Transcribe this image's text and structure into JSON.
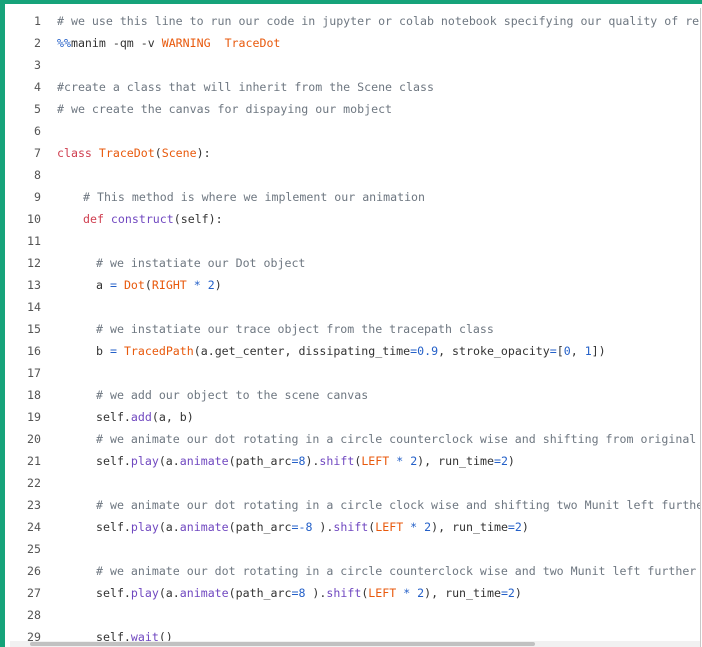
{
  "lines": [
    {
      "num": "1",
      "indent": 0,
      "tokens": [
        {
          "t": "# we use this line to run our code in jupyter or colab notebook specifying our quality of rendering",
          "c": "c"
        }
      ]
    },
    {
      "num": "2",
      "indent": 0,
      "tokens": [
        {
          "t": "%%",
          "c": "n"
        },
        {
          "t": "manim -qm -v ",
          "c": "p"
        },
        {
          "t": "WARNING",
          "c": "o"
        },
        {
          "t": "  ",
          "c": "p"
        },
        {
          "t": "TraceDot",
          "c": "o"
        }
      ]
    },
    {
      "num": "3",
      "indent": 0,
      "tokens": []
    },
    {
      "num": "4",
      "indent": 0,
      "tokens": [
        {
          "t": "#create a class that will inherit from the Scene class",
          "c": "c"
        }
      ]
    },
    {
      "num": "5",
      "indent": 0,
      "tokens": [
        {
          "t": "# we create the canvas for dispaying our mobject",
          "c": "c"
        }
      ]
    },
    {
      "num": "6",
      "indent": 0,
      "tokens": []
    },
    {
      "num": "7",
      "indent": 0,
      "tokens": [
        {
          "t": "class ",
          "c": "k"
        },
        {
          "t": "TraceDot",
          "c": "o"
        },
        {
          "t": "(",
          "c": "p"
        },
        {
          "t": "Scene",
          "c": "o"
        },
        {
          "t": "):",
          "c": "p"
        }
      ]
    },
    {
      "num": "8",
      "indent": 0,
      "tokens": []
    },
    {
      "num": "9",
      "indent": 1,
      "tokens": [
        {
          "t": "# This method is where we implement our animation",
          "c": "c"
        }
      ]
    },
    {
      "num": "10",
      "indent": 1,
      "tokens": [
        {
          "t": "def ",
          "c": "k"
        },
        {
          "t": "construct",
          "c": "f"
        },
        {
          "t": "(self):",
          "c": "p"
        }
      ]
    },
    {
      "num": "11",
      "indent": 0,
      "tokens": []
    },
    {
      "num": "12",
      "indent": 2,
      "tokens": [
        {
          "t": "# we instatiate our Dot object",
          "c": "c"
        }
      ]
    },
    {
      "num": "13",
      "indent": 2,
      "tokens": [
        {
          "t": "a ",
          "c": "p"
        },
        {
          "t": "=",
          "c": "n"
        },
        {
          "t": " ",
          "c": "p"
        },
        {
          "t": "Dot",
          "c": "o"
        },
        {
          "t": "(",
          "c": "p"
        },
        {
          "t": "RIGHT",
          "c": "o"
        },
        {
          "t": " * ",
          "c": "n"
        },
        {
          "t": "2",
          "c": "n"
        },
        {
          "t": ")",
          "c": "p"
        }
      ]
    },
    {
      "num": "14",
      "indent": 0,
      "tokens": []
    },
    {
      "num": "15",
      "indent": 2,
      "tokens": [
        {
          "t": "# we instatiate our trace object from the tracepath class",
          "c": "c"
        }
      ]
    },
    {
      "num": "16",
      "indent": 2,
      "tokens": [
        {
          "t": "b ",
          "c": "p"
        },
        {
          "t": "=",
          "c": "n"
        },
        {
          "t": " ",
          "c": "p"
        },
        {
          "t": "TracedPath",
          "c": "o"
        },
        {
          "t": "(a.get_center, dissipating_time",
          "c": "p"
        },
        {
          "t": "=",
          "c": "n"
        },
        {
          "t": "0.9",
          "c": "n"
        },
        {
          "t": ", stroke_opacity",
          "c": "p"
        },
        {
          "t": "=",
          "c": "n"
        },
        {
          "t": "[",
          "c": "p"
        },
        {
          "t": "0",
          "c": "n"
        },
        {
          "t": ", ",
          "c": "p"
        },
        {
          "t": "1",
          "c": "n"
        },
        {
          "t": "])",
          "c": "p"
        }
      ]
    },
    {
      "num": "17",
      "indent": 0,
      "tokens": []
    },
    {
      "num": "18",
      "indent": 2,
      "tokens": [
        {
          "t": "# we add our object to the scene canvas",
          "c": "c"
        }
      ]
    },
    {
      "num": "19",
      "indent": 2,
      "tokens": [
        {
          "t": "self.",
          "c": "p"
        },
        {
          "t": "add",
          "c": "f"
        },
        {
          "t": "(a, b)",
          "c": "p"
        }
      ]
    },
    {
      "num": "20",
      "indent": 2,
      "tokens": [
        {
          "t": "# we animate our dot rotating in a circle counterclock wise and shifting from original positi",
          "c": "c"
        }
      ]
    },
    {
      "num": "21",
      "indent": 2,
      "tokens": [
        {
          "t": "self.",
          "c": "p"
        },
        {
          "t": "play",
          "c": "f"
        },
        {
          "t": "(a.",
          "c": "p"
        },
        {
          "t": "animate",
          "c": "f"
        },
        {
          "t": "(path_arc",
          "c": "p"
        },
        {
          "t": "=",
          "c": "n"
        },
        {
          "t": "8",
          "c": "n"
        },
        {
          "t": ").",
          "c": "p"
        },
        {
          "t": "shift",
          "c": "f"
        },
        {
          "t": "(",
          "c": "p"
        },
        {
          "t": "LEFT",
          "c": "o"
        },
        {
          "t": " * ",
          "c": "n"
        },
        {
          "t": "2",
          "c": "n"
        },
        {
          "t": "), run_time",
          "c": "p"
        },
        {
          "t": "=",
          "c": "n"
        },
        {
          "t": "2",
          "c": "n"
        },
        {
          "t": ")",
          "c": "p"
        }
      ]
    },
    {
      "num": "22",
      "indent": 0,
      "tokens": []
    },
    {
      "num": "23",
      "indent": 2,
      "tokens": [
        {
          "t": "# we animate our dot rotating in a circle clock wise and shifting two Munit left further",
          "c": "c"
        }
      ]
    },
    {
      "num": "24",
      "indent": 2,
      "tokens": [
        {
          "t": "self.",
          "c": "p"
        },
        {
          "t": "play",
          "c": "f"
        },
        {
          "t": "(a.",
          "c": "p"
        },
        {
          "t": "animate",
          "c": "f"
        },
        {
          "t": "(path_arc",
          "c": "p"
        },
        {
          "t": "=-8",
          "c": "n"
        },
        {
          "t": " ).",
          "c": "p"
        },
        {
          "t": "shift",
          "c": "f"
        },
        {
          "t": "(",
          "c": "p"
        },
        {
          "t": "LEFT",
          "c": "o"
        },
        {
          "t": " * ",
          "c": "n"
        },
        {
          "t": "2",
          "c": "n"
        },
        {
          "t": "), run_time",
          "c": "p"
        },
        {
          "t": "=",
          "c": "n"
        },
        {
          "t": "2",
          "c": "n"
        },
        {
          "t": ")",
          "c": "p"
        }
      ]
    },
    {
      "num": "25",
      "indent": 0,
      "tokens": []
    },
    {
      "num": "26",
      "indent": 2,
      "tokens": [
        {
          "t": "# we animate our dot rotating in a circle counterclock wise and two Munit left further",
          "c": "c"
        }
      ]
    },
    {
      "num": "27",
      "indent": 2,
      "tokens": [
        {
          "t": "self.",
          "c": "p"
        },
        {
          "t": "play",
          "c": "f"
        },
        {
          "t": "(a.",
          "c": "p"
        },
        {
          "t": "animate",
          "c": "f"
        },
        {
          "t": "(path_arc",
          "c": "p"
        },
        {
          "t": "=",
          "c": "n"
        },
        {
          "t": "8",
          "c": "n"
        },
        {
          "t": " ).",
          "c": "p"
        },
        {
          "t": "shift",
          "c": "f"
        },
        {
          "t": "(",
          "c": "p"
        },
        {
          "t": "LEFT",
          "c": "o"
        },
        {
          "t": " * ",
          "c": "n"
        },
        {
          "t": "2",
          "c": "n"
        },
        {
          "t": "), run_time",
          "c": "p"
        },
        {
          "t": "=",
          "c": "n"
        },
        {
          "t": "2",
          "c": "n"
        },
        {
          "t": ")",
          "c": "p"
        }
      ]
    },
    {
      "num": "28",
      "indent": 0,
      "tokens": []
    },
    {
      "num": "29",
      "indent": 2,
      "tokens": [
        {
          "t": "self.",
          "c": "p"
        },
        {
          "t": "wait",
          "c": "f"
        },
        {
          "t": "()",
          "c": "p"
        }
      ]
    }
  ]
}
